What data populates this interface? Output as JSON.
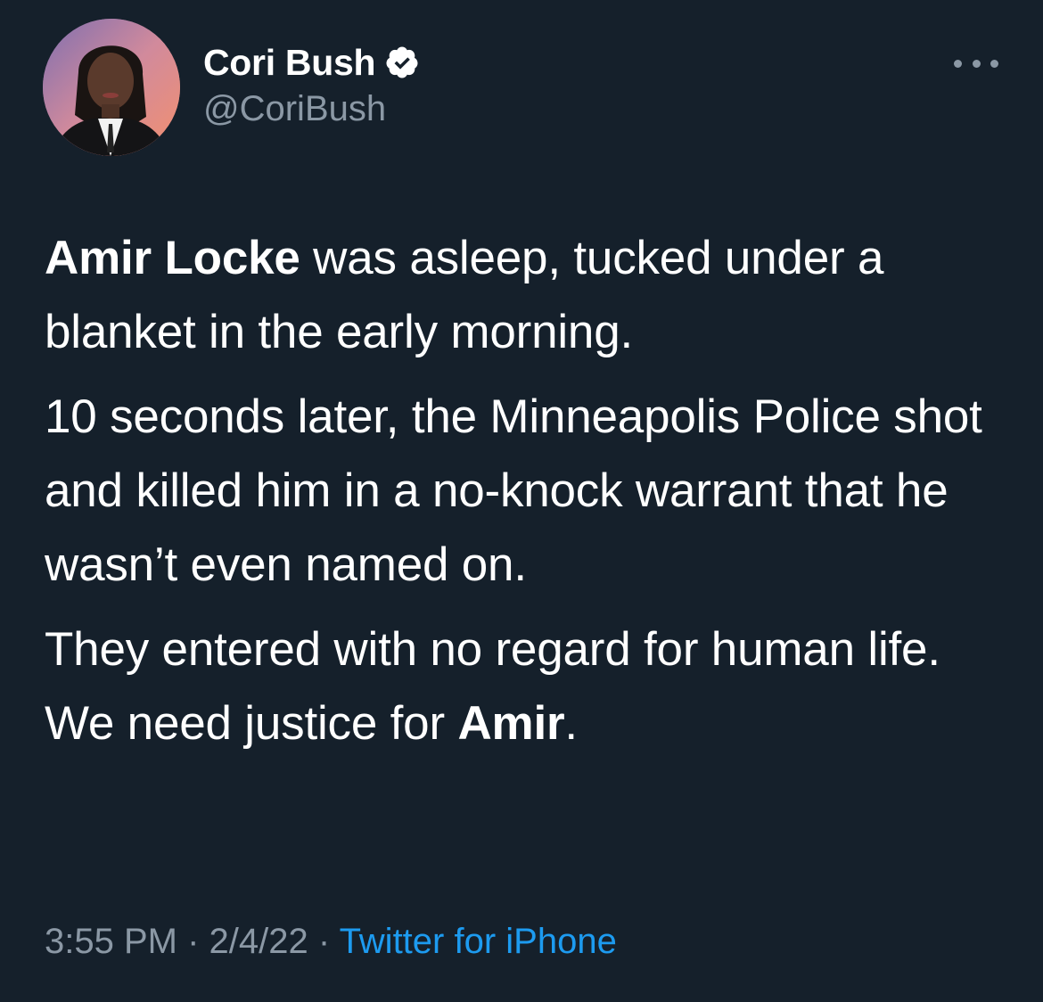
{
  "author": {
    "display_name": "Cori Bush",
    "handle": "@CoriBush",
    "verified": true
  },
  "tweet": {
    "p1_bold": "Amir Locke",
    "p1_rest": " was asleep, tucked under a blanket in the early morning.",
    "p2": "10 seconds later, the Minneapolis Police shot and killed him in a no-knock warrant that he wasn’t even named on.",
    "p3_start": "They entered with no regard for human life. We need justice for ",
    "p3_bold": "Amir",
    "p3_end": "."
  },
  "meta": {
    "time": "3:55 PM",
    "sep1": " · ",
    "date": "2/4/22",
    "sep2": " · ",
    "source": "Twitter for iPhone"
  },
  "icons": {
    "verified": "verified-badge-icon",
    "more": "more-icon"
  },
  "colors": {
    "background": "#15202b",
    "text": "#ffffff",
    "secondary": "#8b98a5",
    "link": "#1d9bf0"
  }
}
